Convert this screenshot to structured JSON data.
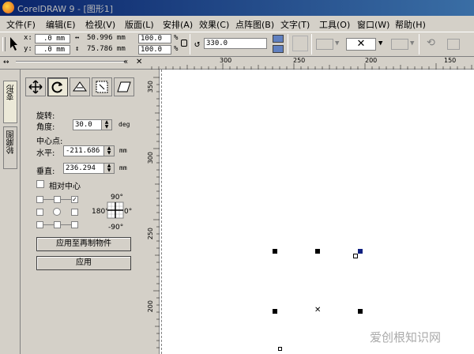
{
  "window": {
    "title": "CorelDRAW 9 - [图形1]"
  },
  "menu": [
    "文件(F)",
    "编辑(E)",
    "检视(V)",
    "版面(L)",
    "安排(A)",
    "效果(C)",
    "点阵图(B)",
    "文字(T)",
    "工具(O)",
    "窗口(W)",
    "帮助(H)"
  ],
  "propbar": {
    "x_label": "x:",
    "x_value": ".0 mm",
    "y_label": "y:",
    "y_value": ".0 mm",
    "width_value": "50.996 mm",
    "height_value": "75.786 mm",
    "scale_x": "100.0",
    "scale_y": "100.0",
    "percent": "%",
    "rotation_value": "330.0"
  },
  "docker": {
    "tabs": [
      "变形",
      "轮廓图"
    ],
    "section_rotate": "旋转:",
    "angle_label": "角度:",
    "angle_value": "30.0",
    "angle_unit": "deg",
    "center_label": "中心点:",
    "h_label": "水平:",
    "h_value": "-211.686",
    "h_unit": "mm",
    "v_label": "垂直:",
    "v_value": "236.294",
    "v_unit": "mm",
    "relative_center": "相对中心",
    "deg_top": "90°",
    "deg_left": "180°",
    "deg_right": "0°",
    "deg_bottom": "-90°",
    "apply_duplicate": "应用至再制物件",
    "apply": "应用"
  },
  "ruler": {
    "h_ticks": [
      "300",
      "250",
      "200",
      "150"
    ],
    "v_ticks": [
      "350",
      "300",
      "250",
      "200"
    ]
  },
  "watermark": "爱创根知识网",
  "colors": {
    "title_bar": "#0a246a",
    "burst": "#ffef3a"
  }
}
